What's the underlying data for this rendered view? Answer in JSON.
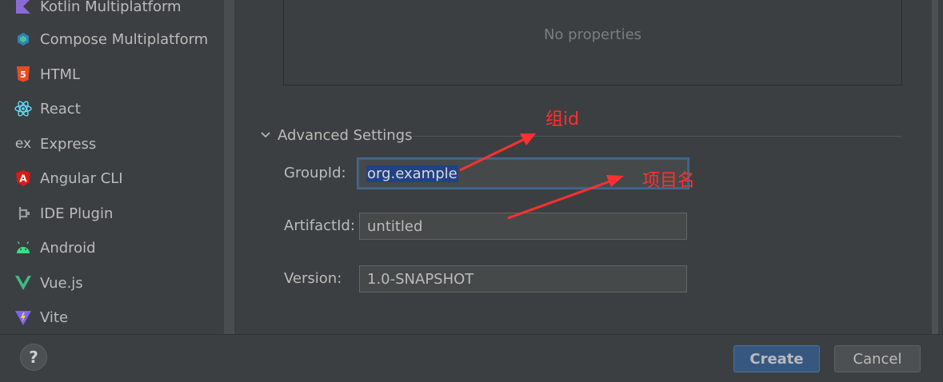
{
  "sidebar": {
    "items": [
      {
        "label": "Kotlin Multiplatform",
        "icon": "kotlin-icon"
      },
      {
        "label": "Compose Multiplatform",
        "icon": "compose-icon"
      },
      {
        "label": "HTML",
        "icon": "html5-icon"
      },
      {
        "label": "React",
        "icon": "react-icon"
      },
      {
        "label": "Express",
        "icon": "express-icon"
      },
      {
        "label": "Angular CLI",
        "icon": "angular-icon"
      },
      {
        "label": "IDE Plugin",
        "icon": "plugin-icon"
      },
      {
        "label": "Android",
        "icon": "android-icon"
      },
      {
        "label": "Vue.js",
        "icon": "vue-icon"
      },
      {
        "label": "Vite",
        "icon": "vite-icon"
      }
    ]
  },
  "properties": {
    "empty_text": "No properties"
  },
  "advanced": {
    "title": "Advanced Settings",
    "group_label": "GroupId:",
    "group_value": "org.example",
    "artifact_label": "ArtifactId:",
    "artifact_value": "untitled",
    "version_label": "Version:",
    "version_value": "1.0-SNAPSHOT"
  },
  "annotations": {
    "group_note": "组id",
    "artifact_note": "项目名",
    "color": "#ff3030"
  },
  "footer": {
    "help_label": "?",
    "create_label": "Create",
    "cancel_label": "Cancel"
  }
}
